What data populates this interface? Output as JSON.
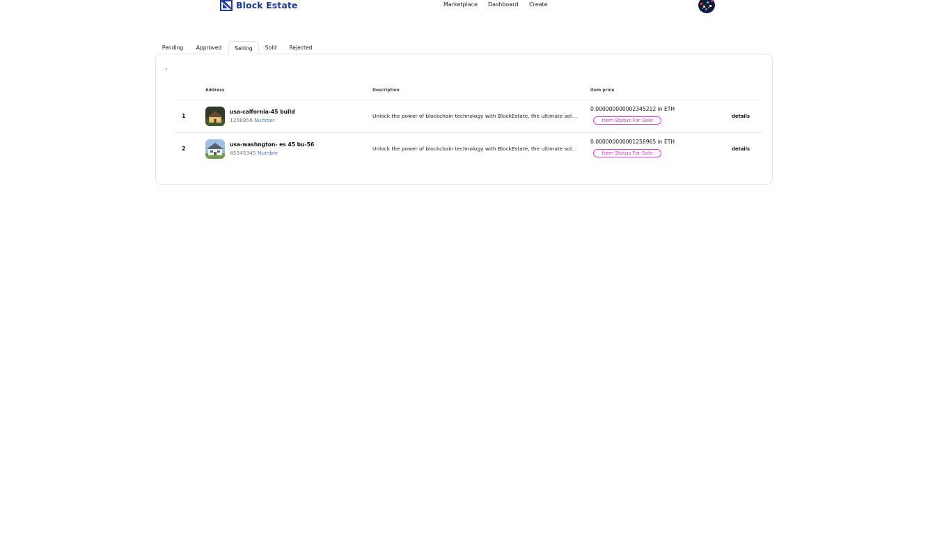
{
  "header": {
    "brand_name": "Block Estate",
    "logo_icon": "block-estate-logo-icon",
    "brand_color": "#1e3a9b",
    "nav": [
      {
        "label": "Marketplace"
      },
      {
        "label": "Dashboard"
      },
      {
        "label": "Create"
      }
    ],
    "avatar_icon": "user-avatar"
  },
  "tabs": [
    {
      "label": "Pending"
    },
    {
      "label": "Approved"
    },
    {
      "label": "Selling",
      "active": true
    },
    {
      "label": "Sold"
    },
    {
      "label": "Rejected"
    }
  ],
  "card": {
    "marker": ",",
    "columns": {
      "address": "Address",
      "description": "Description",
      "price": "item price"
    },
    "rows": [
      {
        "index": "1",
        "thumbnail_icon": "property-thumbnail",
        "title": "usa-calfornia-45 build",
        "number": "1258956",
        "number_label": "Number",
        "description": "Unlock the power of blockchain technology with BlockEstate, the ultimate solution for real estate",
        "price": "0.000000000002345212 in ETH",
        "status": "Item Status For Sale",
        "action": "details"
      },
      {
        "index": "2",
        "thumbnail_icon": "property-thumbnail",
        "title": "usa-washngton- es 45 bu-56",
        "number": "45345345",
        "number_label": "Number",
        "description": "Unlock the power of blockchain technology with BlockEstate, the ultimate solution for real estate",
        "price": "0.000000000001258965 in ETH",
        "status": "Item Status For Sale",
        "action": "details"
      }
    ]
  },
  "colors": {
    "status_badge": "#d632d4",
    "number_label": "#4a7bd6"
  }
}
